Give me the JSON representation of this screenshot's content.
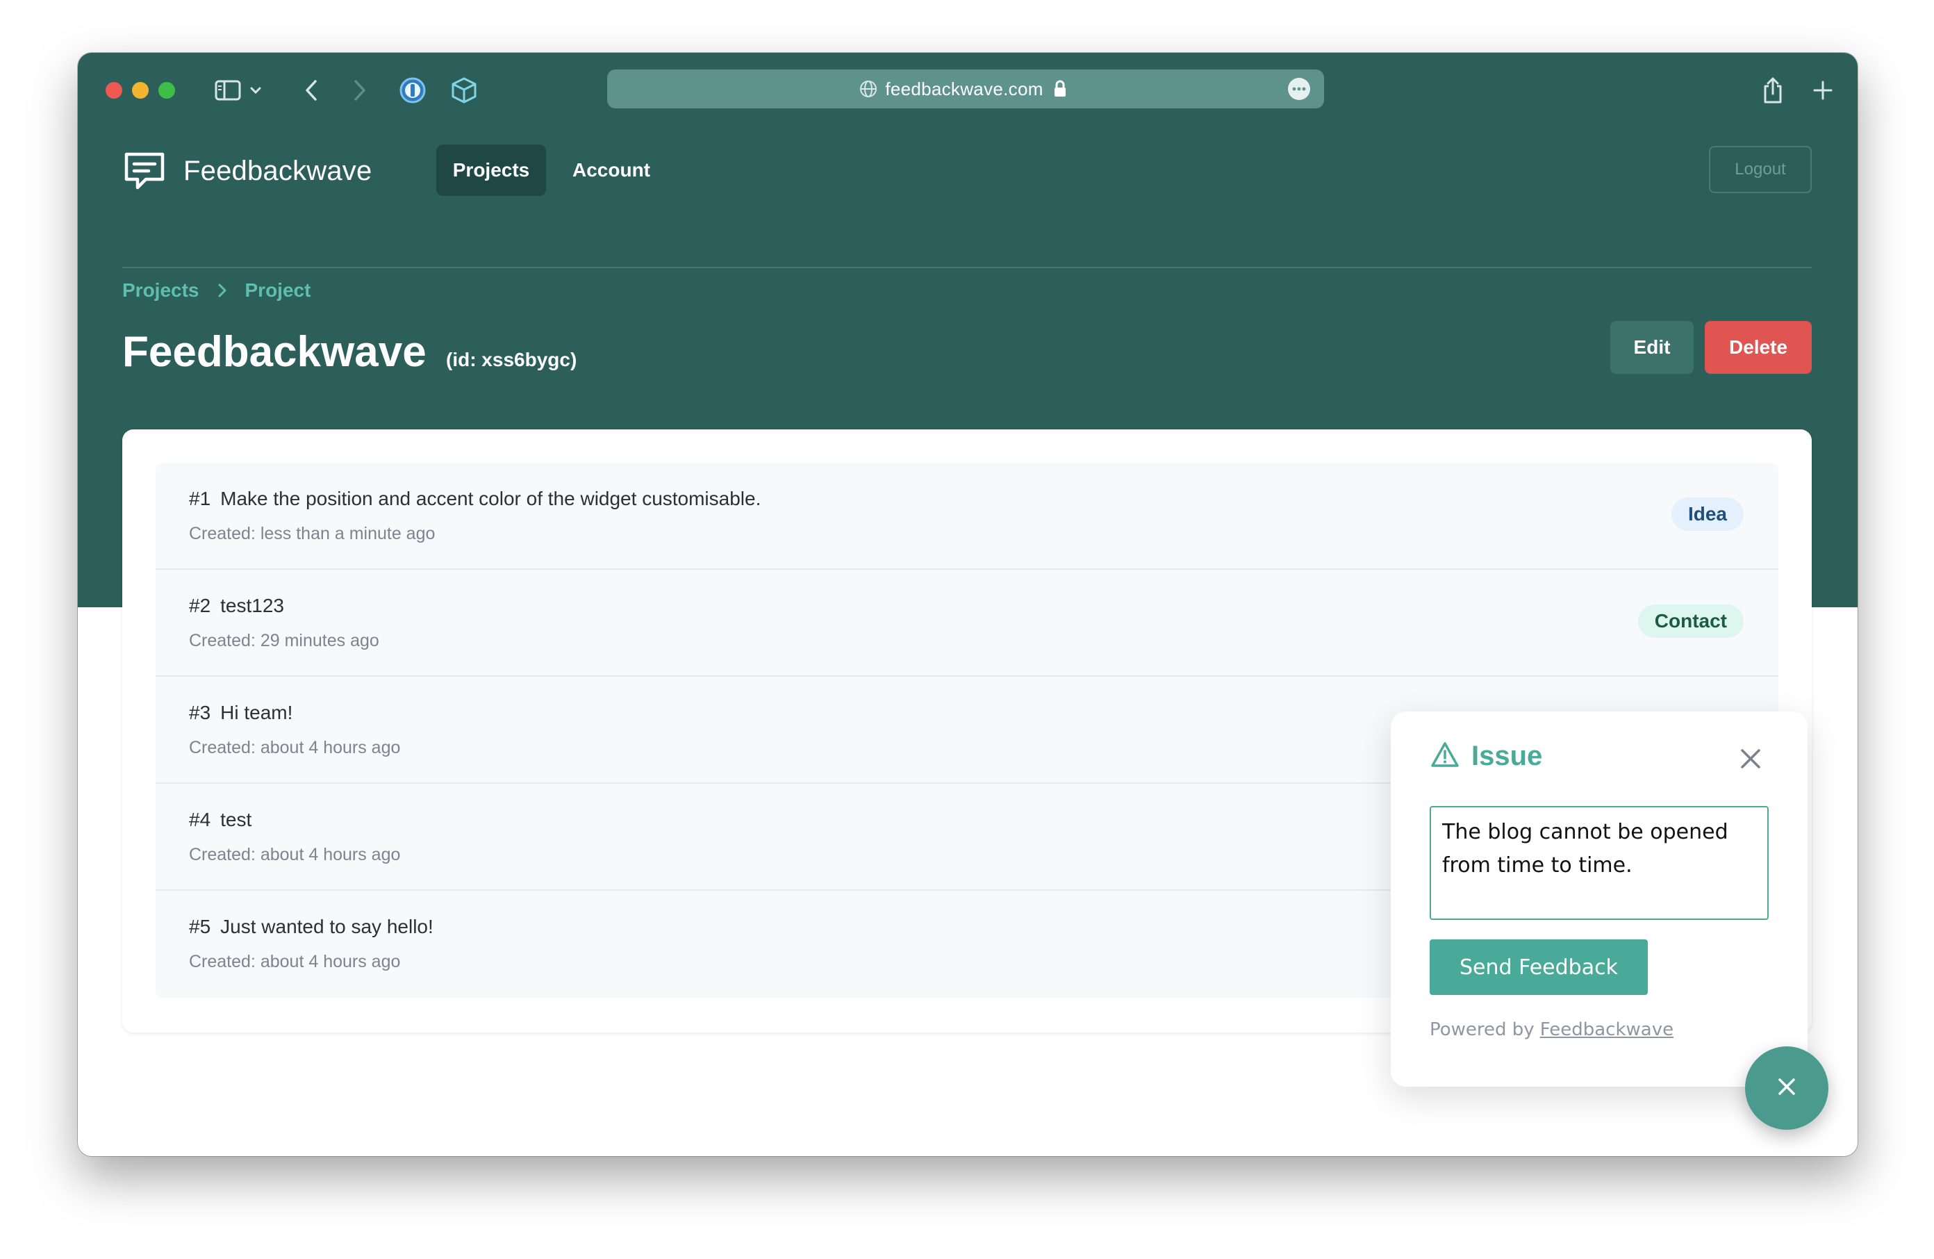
{
  "browser": {
    "url": "feedbackwave.com",
    "icons": [
      "sidebar-icon",
      "chevron-down-icon",
      "back-icon",
      "forward-icon",
      "password-manager-icon",
      "extension-icon",
      "share-icon",
      "new-tab-icon",
      "globe-icon",
      "lock-icon",
      "more-icon"
    ]
  },
  "header": {
    "brand": "Feedbackwave",
    "nav": [
      {
        "label": "Projects",
        "active": true
      },
      {
        "label": "Account",
        "active": false
      }
    ],
    "logout_label": "Logout"
  },
  "breadcrumb": [
    "Projects",
    "Project"
  ],
  "page": {
    "title": "Feedbackwave",
    "id_label": "(id: xss6bygc)",
    "edit_label": "Edit",
    "delete_label": "Delete"
  },
  "feedback": [
    {
      "num": "#1",
      "text": "Make the position and accent color of the widget customisable.",
      "created": "Created: less than a minute ago",
      "badge": "Idea"
    },
    {
      "num": "#2",
      "text": "test123",
      "created": "Created: 29 minutes ago",
      "badge": "Contact"
    },
    {
      "num": "#3",
      "text": "Hi team!",
      "created": "Created: about 4 hours ago",
      "badge": ""
    },
    {
      "num": "#4",
      "text": "test",
      "created": "Created: about 4 hours ago",
      "badge": ""
    },
    {
      "num": "#5",
      "text": "Just wanted to say hello!",
      "created": "Created: about 4 hours ago",
      "badge": ""
    }
  ],
  "widget": {
    "title": "Issue",
    "textarea_value": "The blog cannot be opened from time to time.",
    "send_label": "Send Feedback",
    "powered_prefix": "Powered by",
    "powered_link": "Feedbackwave"
  },
  "colors": {
    "header_bg": "#2c5e5a",
    "accent": "#4aaa99",
    "delete": "#e05452",
    "idea_badge": "#e4f0fb",
    "contact_badge": "#def7ee"
  }
}
